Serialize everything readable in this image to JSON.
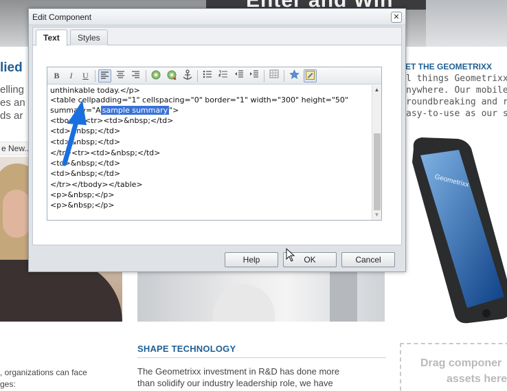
{
  "background": {
    "hero_text": "Enter and Win",
    "left_heading": "lied",
    "left_lines": [
      "elling",
      "es an",
      "ds ar"
    ],
    "news_label": "e New...",
    "right_heading": "ET THE GEOMETRIXX",
    "right_lines": [
      "l things Geometrixx, a",
      "nywhere. Our mobile a",
      "roundbreaking and re",
      "asy-to-use as our sha"
    ],
    "phone_brand": "Geometrixx",
    "left_bottom_lines": [
      ", organizations can face",
      "ges:"
    ],
    "shape_heading": "SHAPE TECHNOLOGY",
    "shape_lines": [
      "The Geometrixx investment in R&D has done more",
      "than solidify our industry leadership role, we have"
    ],
    "drag_lines": [
      "Drag componer",
      "assets here"
    ]
  },
  "dialog": {
    "title": "Edit Component",
    "close_glyph": "✕",
    "tabs": [
      {
        "label": "Text",
        "active": true
      },
      {
        "label": "Styles",
        "active": false
      }
    ],
    "toolbar": {
      "bold": "B",
      "italic": "I",
      "underline": "U",
      "icons": [
        "bold-icon",
        "italic-icon",
        "underline-icon",
        "align-left-icon",
        "align-center-icon",
        "align-right-icon",
        "link-icon",
        "unlink-icon",
        "anchor-icon",
        "bullet-list-icon",
        "numbered-list-icon",
        "outdent-icon",
        "indent-icon",
        "table-icon",
        "special-char-icon",
        "source-edit-icon"
      ]
    },
    "code": {
      "l1": "unthinkable today.</p>",
      "l2": "<table cellpadding=\"1\" cellspacing=\"0\" border=\"1\" width=\"300\" height=\"50\"",
      "l3_pre": "summary=\"A",
      "l3_sel": "sample summary",
      "l3_post": "\">",
      "l4": "<tbody><tr><td>&nbsp;</td>",
      "l5": "<td>&nbsp;</td>",
      "l6": "<td>&nbsp;</td>",
      "l7": "</tr><tr><td>&nbsp;</td>",
      "l8": "<td>&nbsp;</td>",
      "l9": "<td>&nbsp;</td>",
      "l10": "</tr></tbody></table>",
      "l11": "<p>&nbsp;</p>",
      "l12": "<p>&nbsp;</p>"
    },
    "buttons": {
      "help": "Help",
      "ok": "OK",
      "cancel": "Cancel"
    }
  },
  "colors": {
    "heading_blue": "#1f5f93",
    "selection_blue": "#3a72d6",
    "annotation_arrow": "#1a6fe0"
  }
}
